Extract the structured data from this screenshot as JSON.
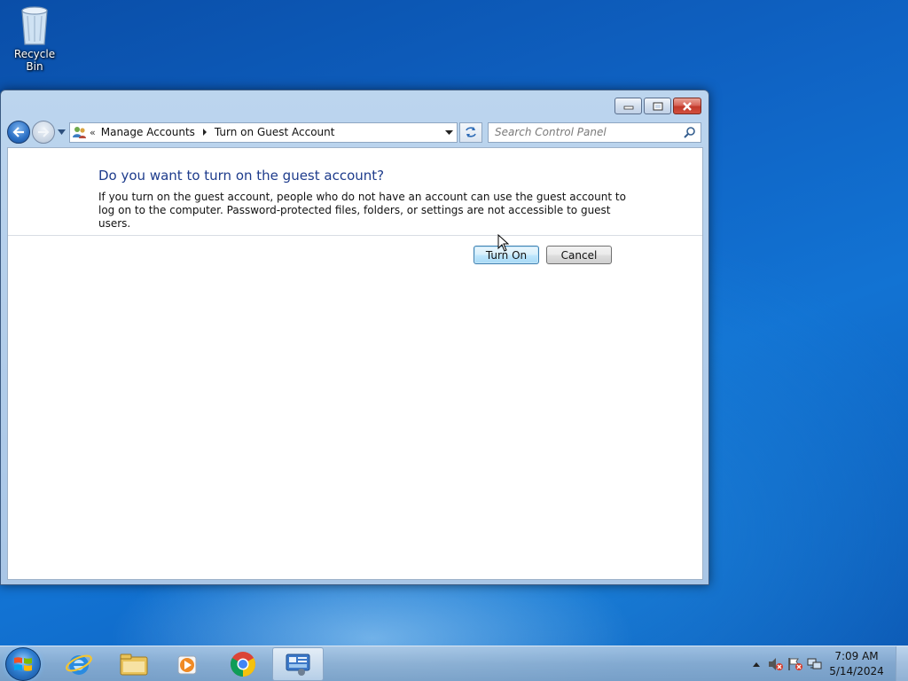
{
  "desktop": {
    "icons": [
      {
        "label": "Recycle Bin",
        "icon": "recycle-bin-icon"
      }
    ]
  },
  "window": {
    "breadcrumb": {
      "chevron": "«",
      "items": [
        "Manage Accounts",
        "Turn on Guest Account"
      ]
    },
    "search": {
      "placeholder": "Search Control Panel"
    },
    "content": {
      "heading": "Do you want to turn on the guest account?",
      "description": "If you turn on the guest account, people who do not have an account can use the guest account to log on to the computer. Password-protected files, folders, or settings are not accessible to guest users.",
      "turn_on_label": "Turn On",
      "cancel_label": "Cancel"
    }
  },
  "taskbar": {
    "pinned": [
      "windows-start-icon",
      "internet-explorer-icon",
      "windows-explorer-icon",
      "windows-media-player-icon",
      "chrome-icon",
      "control-panel-icon"
    ],
    "clock": {
      "time": "7:09 AM",
      "date": "5/14/2024"
    }
  },
  "colors": {
    "heading": "#1e3c8c",
    "desktop": "#0f63c4",
    "close_button": "#c2392a"
  }
}
